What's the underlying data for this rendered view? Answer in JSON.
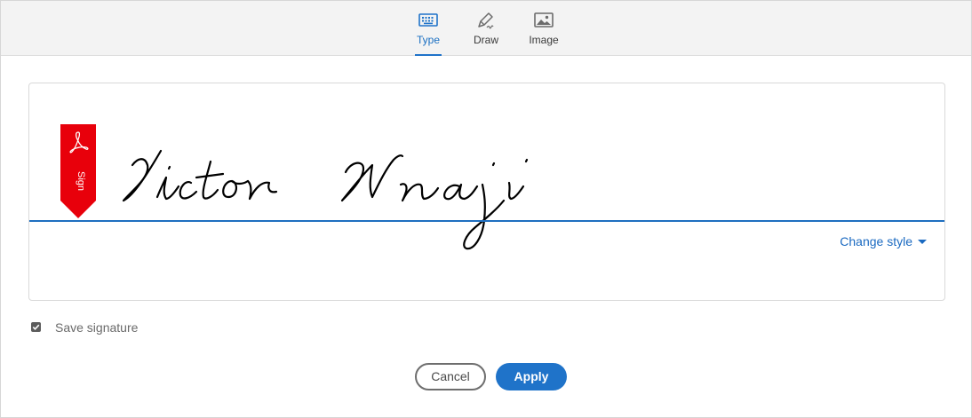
{
  "tabs": [
    {
      "label": "Type",
      "icon": "keyboard-icon",
      "active": true
    },
    {
      "label": "Draw",
      "icon": "pen-icon",
      "active": false
    },
    {
      "label": "Image",
      "icon": "image-icon",
      "active": false
    }
  ],
  "signature": {
    "text": "Victor Nnaji",
    "badge_label": "Sign",
    "badge_color": "#e8000b",
    "line_color": "#1f6fc0",
    "change_style_label": "Change style"
  },
  "save_signature": {
    "label": "Save signature",
    "checked": true
  },
  "buttons": {
    "cancel": "Cancel",
    "apply": "Apply"
  },
  "colors": {
    "accent": "#1f73c9",
    "tabbar_bg": "#f3f3f3"
  }
}
